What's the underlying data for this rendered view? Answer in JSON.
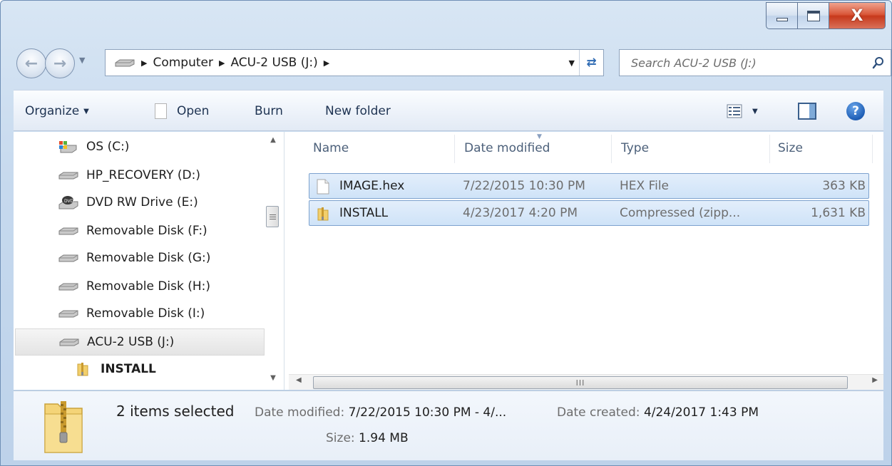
{
  "window": {
    "minimize_icon": "minimize-icon",
    "maximize_icon": "maximize-icon",
    "close_glyph": "X"
  },
  "address_bar": {
    "breadcrumbs": [
      "Computer",
      "ACU-2 USB (J:)"
    ],
    "search_placeholder": "Search ACU-2 USB (J:)"
  },
  "toolbar": {
    "organize": "Organize",
    "open": "Open",
    "burn": "Burn",
    "new_folder": "New folder"
  },
  "nav_pane": {
    "items": [
      {
        "label": "OS (C:)",
        "icon": "os-drive-icon"
      },
      {
        "label": "HP_RECOVERY (D:)",
        "icon": "drive-icon"
      },
      {
        "label": "DVD RW Drive (E:)",
        "icon": "dvd-drive-icon"
      },
      {
        "label": "Removable Disk (F:)",
        "icon": "drive-icon"
      },
      {
        "label": "Removable Disk (G:)",
        "icon": "drive-icon"
      },
      {
        "label": "Removable Disk (H:)",
        "icon": "drive-icon"
      },
      {
        "label": "Removable Disk (I:)",
        "icon": "drive-icon"
      },
      {
        "label": "ACU-2 USB (J:)",
        "icon": "drive-icon",
        "selected": true
      },
      {
        "label": "INSTALL",
        "icon": "zip-folder-icon"
      }
    ]
  },
  "file_list": {
    "columns": [
      "Name",
      "Date modified",
      "Type",
      "Size"
    ],
    "rows": [
      {
        "name": "IMAGE.hex",
        "date": "7/22/2015 10:30 PM",
        "type": "HEX File",
        "size": "363 KB",
        "icon": "file-icon"
      },
      {
        "name": "INSTALL",
        "date": "4/23/2017 4:20 PM",
        "type": "Compressed (zipp...",
        "size": "1,631 KB",
        "icon": "zip-folder-icon"
      }
    ],
    "scroll_grip": "III"
  },
  "details": {
    "count": "2 items selected",
    "date_modified_label": "Date modified:",
    "date_modified_value": "7/22/2015 10:30 PM - 4/...",
    "date_created_label": "Date created:",
    "date_created_value": "4/24/2017 1:43 PM",
    "size_label": "Size:",
    "size_value": "1.94 MB"
  },
  "colors": {
    "selection_fill": "#cfe3f8",
    "selection_border": "#7da2ce",
    "close_button": "#c7391c",
    "frame": "#bdd2ea"
  }
}
